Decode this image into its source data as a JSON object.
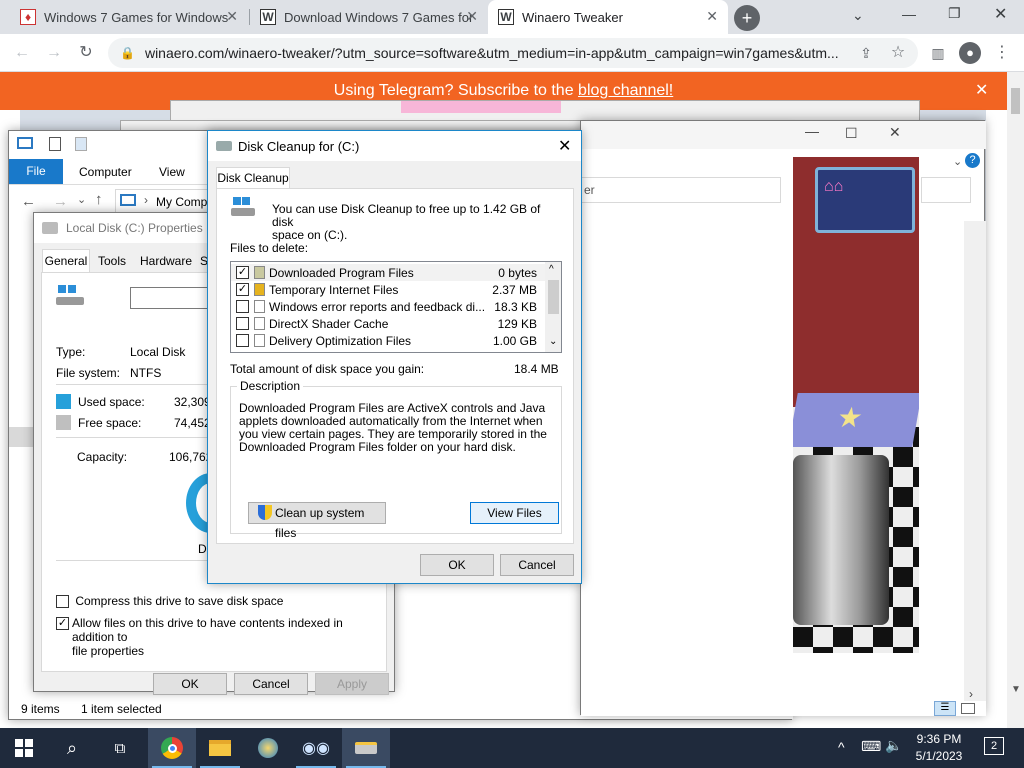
{
  "browser": {
    "tabs": [
      {
        "title": "Windows 7 Games for Windows",
        "favicon": "W"
      },
      {
        "title": "Download Windows 7 Games for",
        "favicon": "W"
      },
      {
        "title": "Winaero Tweaker",
        "favicon": "W"
      }
    ],
    "url": "winaero.com/winaero-tweaker/?utm_source=software&utm_medium=in-app&utm_campaign=win7games&utm..."
  },
  "banner": {
    "text": "Using Telegram? Subscribe to the ",
    "link": "blog channel!"
  },
  "explorer": {
    "ribbon_tabs": [
      "File",
      "Computer",
      "View"
    ],
    "breadcrumb": "My Comp",
    "status_items": "9 items",
    "status_selected": "1 item selected"
  },
  "background_window": {
    "search_placeholder": "er"
  },
  "properties": {
    "title": "Local Disk (C:) Properties",
    "tabs": [
      "General",
      "Tools",
      "Hardware",
      "Sh"
    ],
    "type_label": "Type:",
    "type_value": "Local Disk",
    "fs_label": "File system:",
    "fs_value": "NTFS",
    "used_label": "Used space:",
    "used_value": "32,309",
    "free_label": "Free space:",
    "free_value": "74,452",
    "capacity_label": "Capacity:",
    "capacity_value": "106,762",
    "drive_label": "Dr",
    "compress": "Compress this drive to save disk space",
    "index_line1": "Allow files on this drive to have contents indexed in addition to",
    "index_line2": "file properties",
    "ok": "OK",
    "cancel": "Cancel",
    "apply": "Apply",
    "colors": {
      "used": "#26a0da",
      "free": "#bfbfbf"
    }
  },
  "cleanup": {
    "title": "Disk Cleanup for  (C:)",
    "tab": "Disk Cleanup",
    "intro_line1": "You can use Disk Cleanup to free up to 1.42 GB of disk",
    "intro_line2": "space on  (C:).",
    "files_label": "Files to delete:",
    "files": [
      {
        "name": "Downloaded Program Files",
        "size": "0 bytes",
        "checked": true
      },
      {
        "name": "Temporary Internet Files",
        "size": "2.37 MB",
        "checked": true
      },
      {
        "name": "Windows error reports and feedback di...",
        "size": "18.3 KB",
        "checked": false
      },
      {
        "name": "DirectX Shader Cache",
        "size": "129 KB",
        "checked": false
      },
      {
        "name": "Delivery Optimization Files",
        "size": "1.00 GB",
        "checked": false
      }
    ],
    "total_label": "Total amount of disk space you gain:",
    "total_value": "18.4 MB",
    "desc_label": "Description",
    "desc_text": "Downloaded Program Files are ActiveX controls and Java applets downloaded automatically from the Internet when you view certain pages. They are temporarily stored in the Downloaded Program Files folder on your hard disk.",
    "cleanup_system": "Clean up system files",
    "view_files": "View Files",
    "ok": "OK",
    "cancel": "Cancel"
  },
  "taskbar": {
    "time": "9:36 PM",
    "date": "5/1/2023",
    "notifications": "2"
  }
}
